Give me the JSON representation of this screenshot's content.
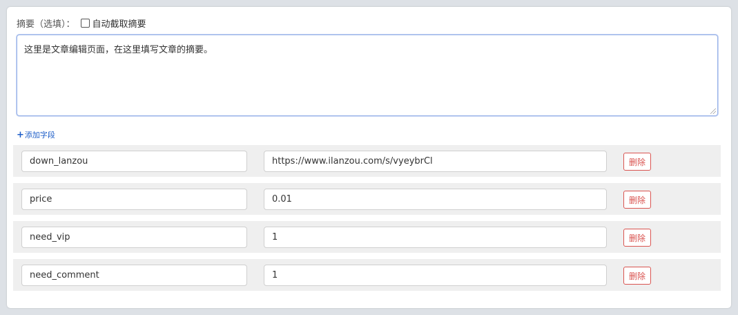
{
  "excerpt": {
    "label": "摘要（选填）：",
    "auto_label": "自动截取摘要",
    "auto_checked": false,
    "text": "这里是文章编辑页面，在这里填写文章的摘要。"
  },
  "custom_fields": {
    "add_label": "添加字段",
    "delete_label": "删除",
    "rows": [
      {
        "key": "down_lanzou",
        "value": "https://www.ilanzou.com/s/vyeybrCl"
      },
      {
        "key": "price",
        "value": "0.01"
      },
      {
        "key": "need_vip",
        "value": "1"
      },
      {
        "key": "need_comment",
        "value": "1"
      }
    ]
  },
  "colors": {
    "accent": "#1e5ec8",
    "danger": "#d9534f",
    "row_bg": "#efefef"
  }
}
